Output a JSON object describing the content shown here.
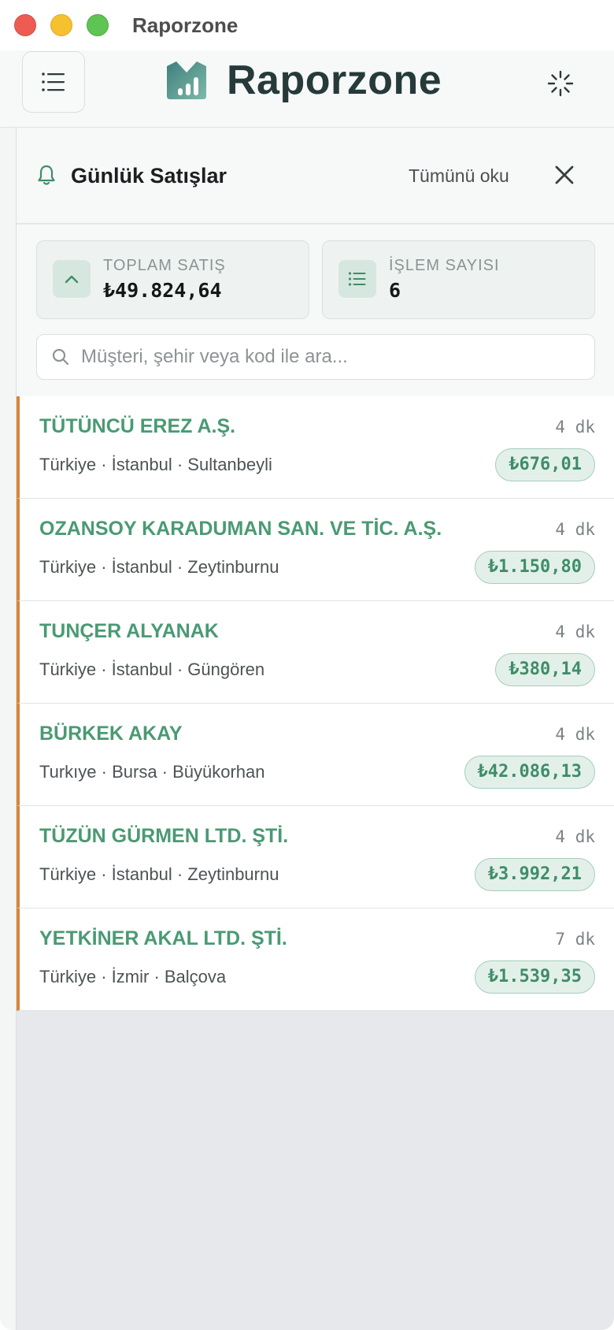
{
  "window": {
    "title": "Raporzone"
  },
  "header": {
    "brand": "Raporzone"
  },
  "panel": {
    "title": "Günlük Satışlar",
    "read_all": "Tümünü oku"
  },
  "stats": [
    {
      "label": "TOPLAM SATIŞ",
      "value": "₺49.824,64",
      "icon": "chevron-up-icon"
    },
    {
      "label": "İŞLEM SAYISI",
      "value": "6",
      "icon": "list-icon"
    }
  ],
  "search": {
    "placeholder": "Müşteri, şehir veya kod ile ara...",
    "value": ""
  },
  "sales": [
    {
      "name": "TÜTÜNCÜ EREZ A.Ş.",
      "time": "4 dk",
      "location": "Türkiye · İstanbul · Sultanbeyli",
      "amount": "₺676,01"
    },
    {
      "name": "OZANSOY KARADUMAN SAN. VE TİC. A.Ş.",
      "time": "4 dk",
      "location": "Türkiye · İstanbul · Zeytinburnu",
      "amount": "₺1.150,80"
    },
    {
      "name": "TUNÇER ALYANAK",
      "time": "4 dk",
      "location": "Türkiye · İstanbul · Güngören",
      "amount": "₺380,14"
    },
    {
      "name": "BÜRKEK AKAY",
      "time": "4 dk",
      "location": "Turkıye · Bursa · Büyükorhan",
      "amount": "₺42.086,13"
    },
    {
      "name": "TÜZÜN GÜRMEN LTD. ŞTİ.",
      "time": "4 dk",
      "location": "Türkiye · İstanbul · Zeytinburnu",
      "amount": "₺3.992,21"
    },
    {
      "name": "YETKİNER AKAL LTD. ŞTİ.",
      "time": "7 dk",
      "location": "Türkiye · İzmir · Balçova",
      "amount": "₺1.539,35"
    }
  ],
  "colors": {
    "accent": "#4a9a73",
    "row_marker": "#d7853a",
    "brand_dark": "#263a3a"
  }
}
